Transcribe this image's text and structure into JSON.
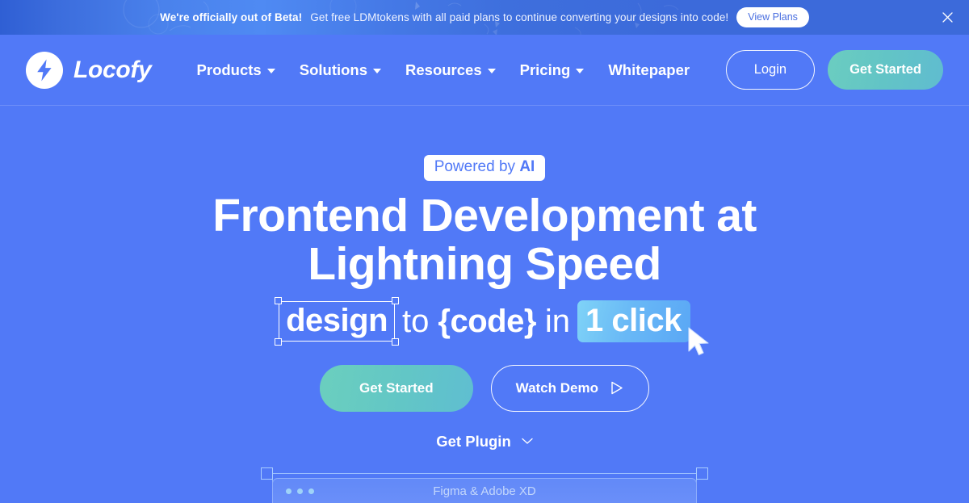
{
  "banner": {
    "bold_text": "We're officially out of Beta!",
    "text": "Get free LDMtokens with all paid plans to continue converting your designs into code!",
    "cta_label": "View Plans",
    "close_icon": "close-icon",
    "bg_color": "#3c6ada"
  },
  "nav": {
    "logo_icon": "lightning-bolt-icon",
    "brand": "Locofy",
    "items": [
      {
        "label": "Products",
        "has_dropdown": true
      },
      {
        "label": "Solutions",
        "has_dropdown": true
      },
      {
        "label": "Resources",
        "has_dropdown": true
      },
      {
        "label": "Pricing",
        "has_dropdown": true
      },
      {
        "label": "Whitepaper",
        "has_dropdown": false
      }
    ],
    "login_label": "Login",
    "get_started_label": "Get Started",
    "accent_color": "#62c4c6"
  },
  "hero": {
    "badge_prefix": "Powered by ",
    "badge_strong": "AI",
    "title_line1": "Frontend Development at",
    "title_line2": "Lightning Speed",
    "subtitle": {
      "design_word": "design",
      "to_word": "to",
      "code_word": "{code}",
      "in_word": "in",
      "click_word": "1 click",
      "cursor_icon": "cursor-arrow-icon"
    },
    "primary_cta": "Get Started",
    "secondary_cta": "Watch Demo",
    "secondary_cta_icon": "play-icon",
    "plugin_label": "Get Plugin",
    "plugin_icon": "chevron-down-icon",
    "bg_color": "#5179f7"
  },
  "mockup": {
    "window_title": "Figma & Adobe XD",
    "dots": [
      "dot-1",
      "dot-2",
      "dot-3"
    ]
  }
}
